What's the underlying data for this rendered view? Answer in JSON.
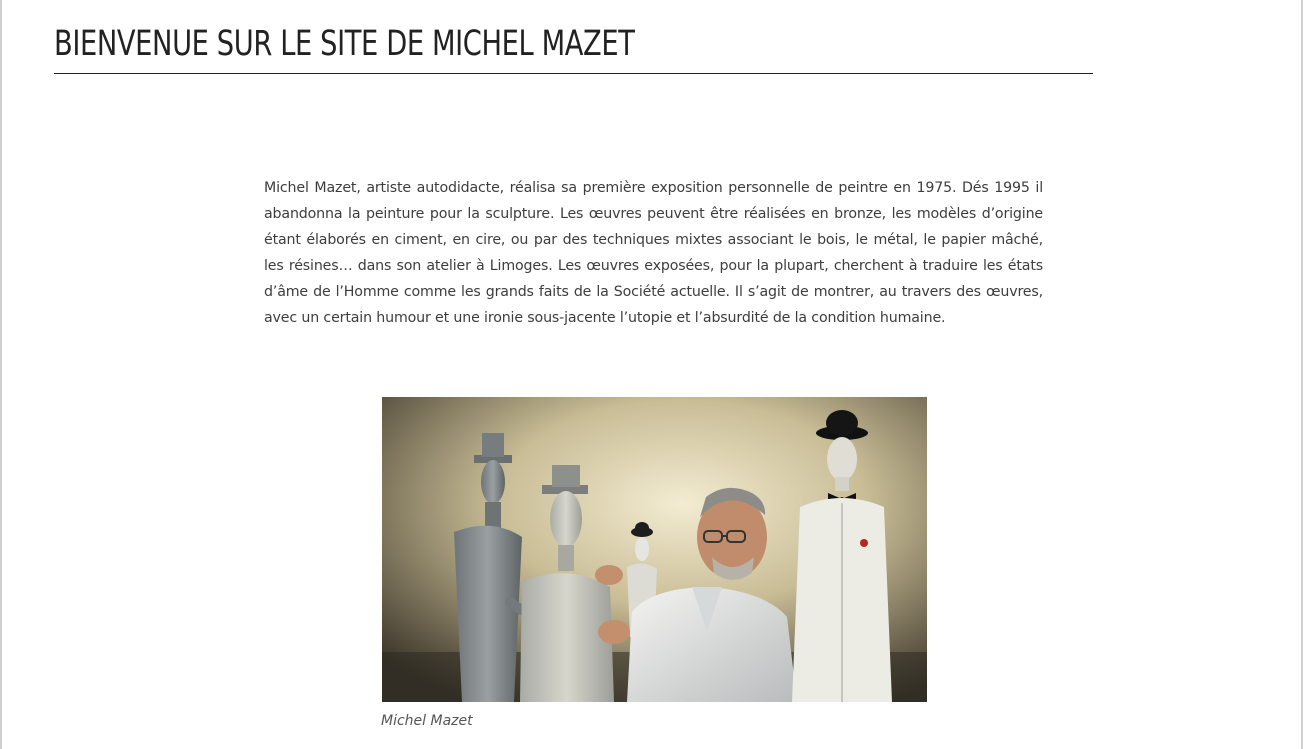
{
  "page": {
    "title": "Bienvenue sur le site de Michel Mazet",
    "intro_text": "Michel Mazet, artiste autodidacte, réalisa sa première exposition personnelle de peintre en 1975. Dés 1995 il abandonna la peinture pour la sculpture. Les œuvres peuvent être réalisées en bronze, les modèles d’origine étant élaborés en ciment, en cire, ou par des techniques mixtes associant le bois, le métal, le papier mâché, les résines… dans son atelier à Limoges. Les œuvres exposées, pour la plupart, cherchent à traduire les états d’âme de l’Homme comme les grands faits de la Société actuelle. Il s’agit de montrer, au travers des œuvres, avec un certain humour et une ironie sous-jacente l’utopie et l’absurdité de la condition humaine."
  },
  "photo": {
    "caption": "Michel Mazet"
  }
}
